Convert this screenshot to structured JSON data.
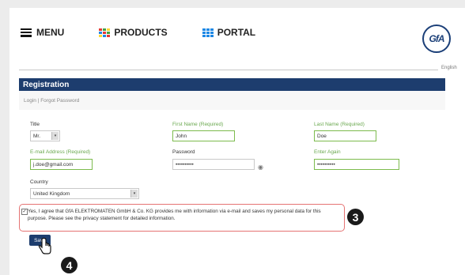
{
  "header": {
    "menu_label": "MENU",
    "products_label": "PRODUCTS",
    "portal_label": "PORTAL",
    "logo_text": "GfA",
    "language": "English",
    "grid_colors": [
      "#e53935",
      "#43a047",
      "#fdd835",
      "#1e88e5"
    ]
  },
  "form": {
    "title": "Registration",
    "sublinks": "Login | Forgot Password",
    "title_label": "Title",
    "title_value": "Mr.",
    "first_name_label": "First Name (Required)",
    "first_name_value": "John",
    "last_name_label": "Last Name (Required)",
    "last_name_value": "Doe",
    "email_label": "E-mail Address (Required)",
    "email_value": "j.doe@gmail.com",
    "password_label": "Password",
    "password_value": "••••••••••",
    "enter_again_label": "Enter Again",
    "enter_again_value": "••••••••••",
    "country_label": "Country",
    "country_value": "United Kingdom",
    "consent_checked": true,
    "consent_text": "Yes, I agree that GfA ELEKTROMATEN GmbH & Co. KG provides me with information via e-mail and saves my personal data for this purpose. Please see the privacy statement for detailed information.",
    "save_label": "Save"
  },
  "annotations": {
    "step3": "3",
    "step4": "4"
  }
}
